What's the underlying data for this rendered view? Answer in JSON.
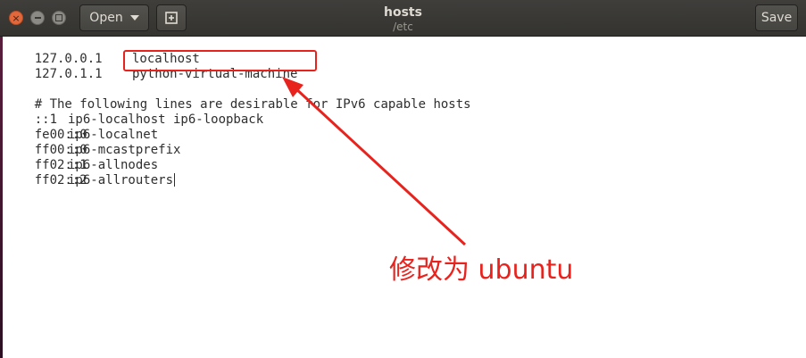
{
  "window": {
    "title": "hosts",
    "subtitle": "/etc"
  },
  "toolbar": {
    "open_label": "Open",
    "save_label": "Save"
  },
  "icons": {
    "close": "close-icon",
    "minimize": "minimize-icon",
    "maximize": "maximize-icon",
    "open_menu": "chevron-down-icon",
    "new_document": "new-document-icon"
  },
  "editor": {
    "lines": [
      {
        "addr": "127.0.0.1",
        "host": "localhost"
      },
      {
        "addr": "127.0.1.1",
        "host": "python-virtual-machine"
      },
      {
        "text": ""
      },
      {
        "text": "# The following lines are desirable for IPv6 capable hosts"
      },
      {
        "addr": "::1",
        "host": "ip6-localhost ip6-loopback"
      },
      {
        "addr": "fe00::0",
        "host": "ip6-localnet"
      },
      {
        "addr": "ff00::0",
        "host": "ip6-mcastprefix"
      },
      {
        "addr": "ff02::1",
        "host": "ip6-allnodes"
      },
      {
        "addr": "ff02::2",
        "host": "ip6-allrouters"
      }
    ]
  },
  "annotation": {
    "note": "修改为 ubuntu",
    "color": "#e8231e"
  }
}
